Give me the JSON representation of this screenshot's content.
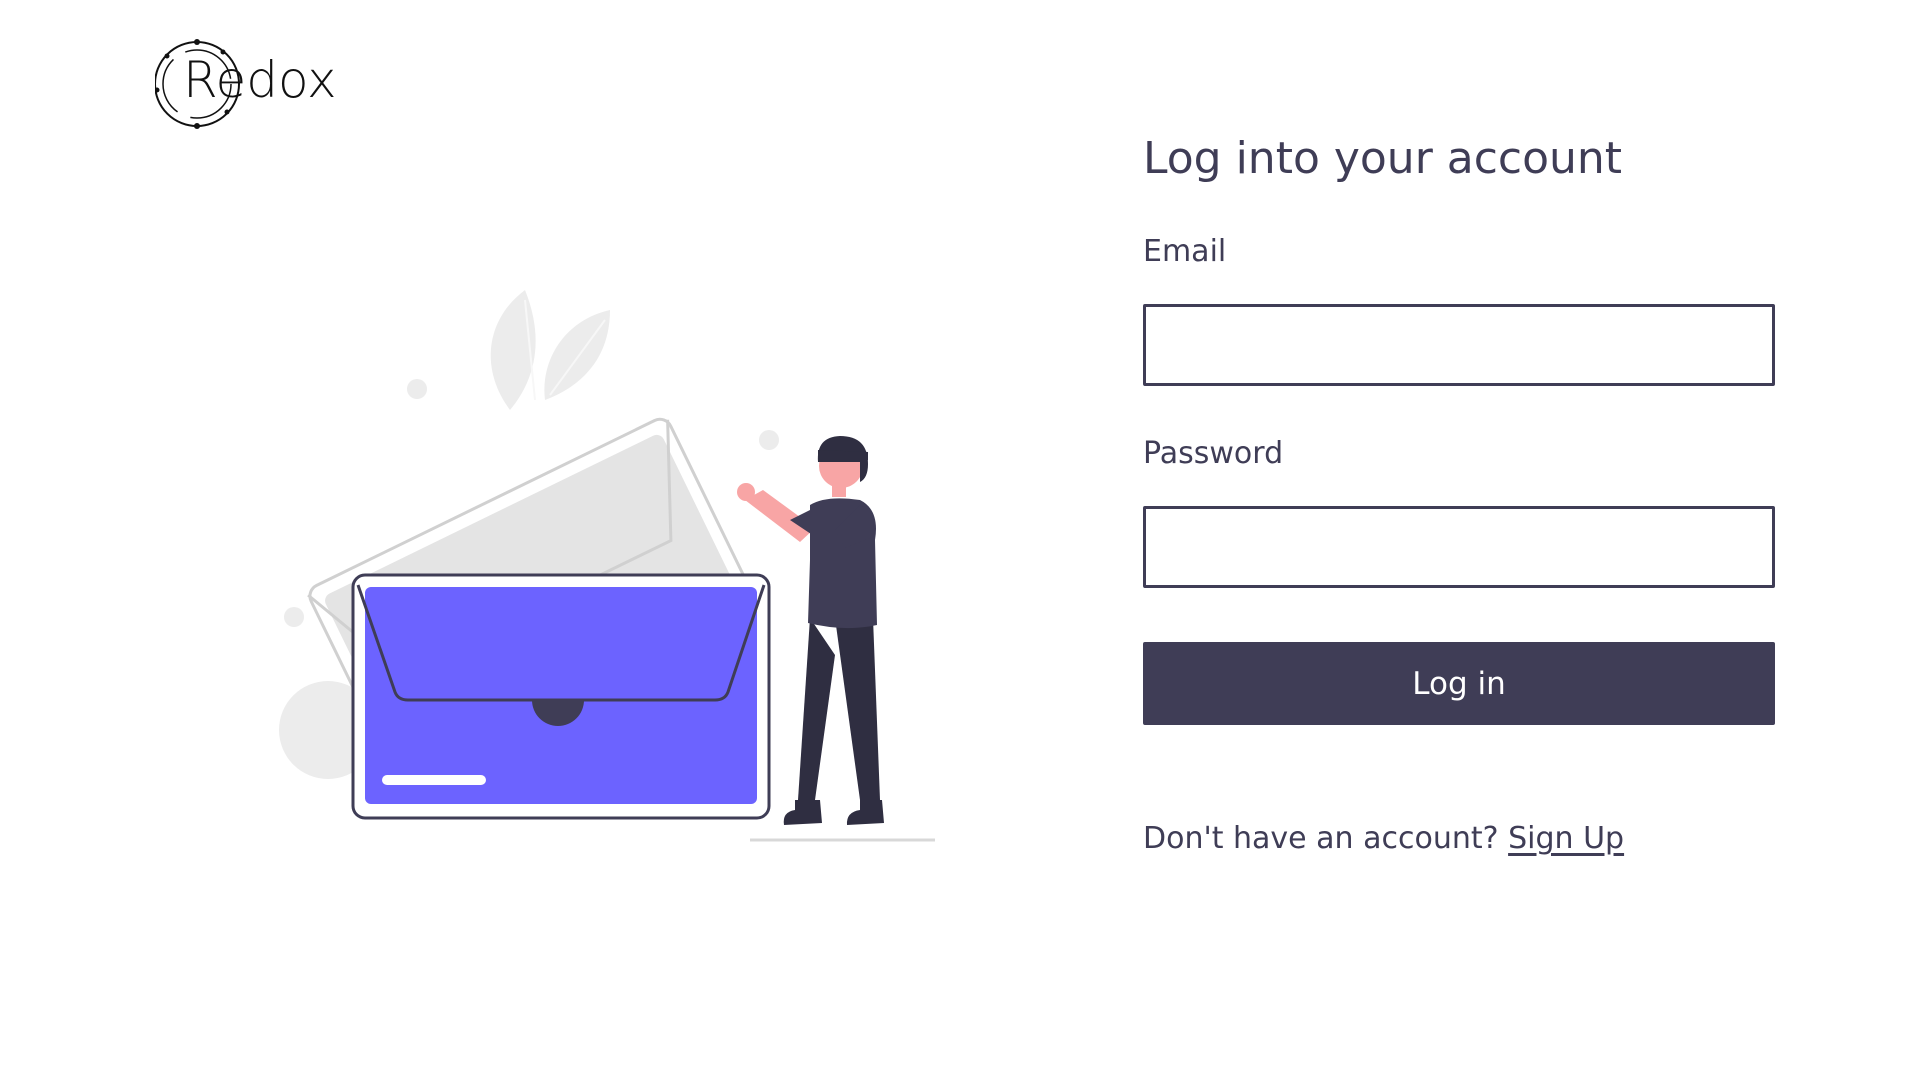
{
  "brand": {
    "logo_text": "Redox"
  },
  "form": {
    "title": "Log into your account",
    "email_label": "Email",
    "email_value": "",
    "password_label": "Password",
    "password_value": "",
    "login_button": "Log in",
    "signup_prompt": "Don't have an account?",
    "signup_link": "Sign Up"
  },
  "colors": {
    "primary_dark": "#3f3d56",
    "accent": "#6c63ff",
    "background": "#ffffff",
    "muted": "#e6e6e6"
  },
  "icons": {
    "illustration": "person-opening-envelope-illustration",
    "logo": "redox-logo"
  }
}
